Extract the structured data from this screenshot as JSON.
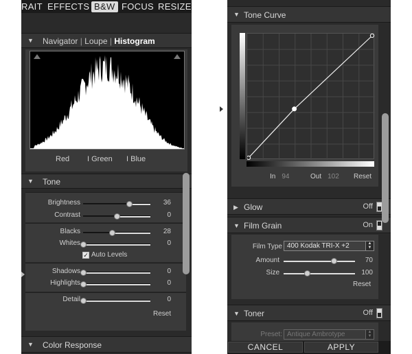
{
  "left_panel": {
    "tabs": [
      {
        "label": "RAIT",
        "active": false
      },
      {
        "label": "EFFECTS",
        "active": false
      },
      {
        "label": "B&W",
        "active": true
      },
      {
        "label": "FOCUS",
        "active": false
      },
      {
        "label": "RESIZE",
        "active": false
      }
    ],
    "navigator": {
      "views": [
        "Navigator",
        "Loupe",
        "Histogram"
      ],
      "active_view": "Histogram",
      "separator": "|",
      "channels": [
        "Red",
        "I Green",
        "I Blue"
      ]
    },
    "tone": {
      "title": "Tone",
      "sliders": [
        {
          "label": "Brightness",
          "value": "36",
          "level": 0.68
        },
        {
          "label": "Contrast",
          "value": "0",
          "level": 0.5
        },
        {
          "label": "Blacks",
          "value": "28",
          "level": 0.43
        },
        {
          "label": "Whites",
          "value": "0",
          "level": 0.0
        },
        {
          "label": "Shadows",
          "value": "0",
          "level": 0.0
        },
        {
          "label": "Highlights",
          "value": "0",
          "level": 0.0
        },
        {
          "label": "Detail",
          "value": "0",
          "level": 0.0
        }
      ],
      "auto_levels": {
        "label": "Auto Levels",
        "checked": true
      },
      "reset_label": "Reset"
    },
    "color_response": {
      "title": "Color Response"
    }
  },
  "right_panel": {
    "tone_curve": {
      "title": "Tone Curve",
      "in_label": "In",
      "in_value": "94",
      "out_label": "Out",
      "out_value": "102",
      "reset_label": "Reset",
      "curve_points": [
        [
          0,
          0
        ],
        [
          0.37,
          0.4
        ],
        [
          1,
          1
        ]
      ]
    },
    "glow": {
      "title": "Glow",
      "state": "Off"
    },
    "film_grain": {
      "title": "Film Grain",
      "state": "On",
      "film_type_label": "Film Type",
      "film_type_value": "400 Kodak TRI-X +2",
      "amount_label": "Amount",
      "amount_value": "70",
      "amount_level": 0.7,
      "size_label": "Size",
      "size_value": "100",
      "size_level": 0.33,
      "reset_label": "Reset"
    },
    "toner": {
      "title": "Toner",
      "state": "Off",
      "preset_label": "Preset:",
      "preset_value": "Antique Ambrotype"
    },
    "buttons": {
      "cancel": "CANCEL",
      "apply": "APPLY"
    }
  },
  "colors": {
    "panel_bg": "#2a2a2a",
    "group_bg": "#3a3a3a",
    "header_bg": "#353535",
    "text": "#d0d0d0"
  }
}
